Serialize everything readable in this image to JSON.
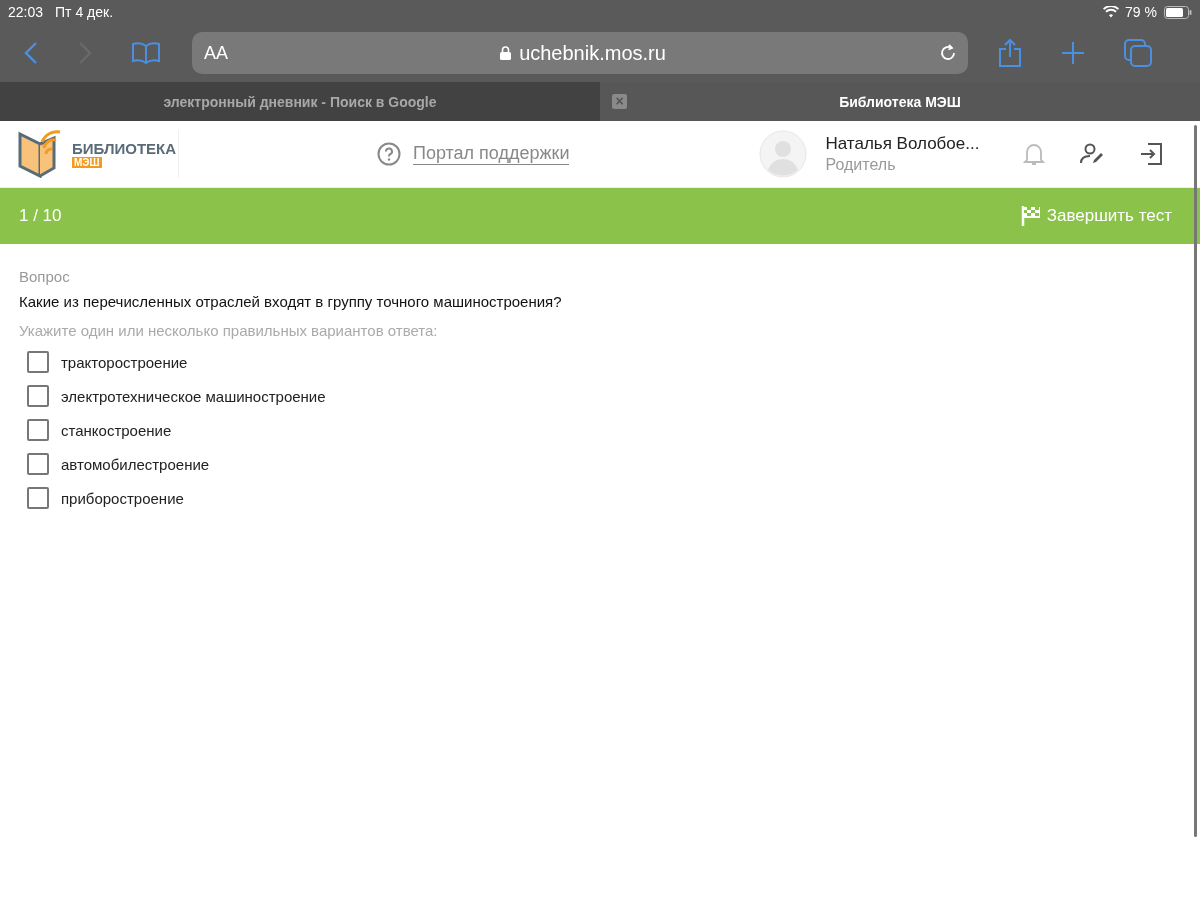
{
  "status_bar": {
    "time": "22:03",
    "date": "Пт 4 дек.",
    "battery": "79 %"
  },
  "browser": {
    "text_size": "AA",
    "url": "uchebnik.mos.ru"
  },
  "tabs": [
    {
      "title": "электронный дневник - Поиск в Google",
      "selected": false
    },
    {
      "title": "Библиотека МЭШ",
      "selected": true,
      "close": "×"
    }
  ],
  "site_header": {
    "logo_title": "БИБЛИОТЕКА",
    "logo_sub": "МЭШ",
    "support_link": "Портал поддержки",
    "user_name": "Наталья Волобое...",
    "user_role": "Родитель"
  },
  "test_bar": {
    "counter": "1 / 10",
    "finish": "Завершить тест"
  },
  "question": {
    "label": "Вопрос",
    "text": "Какие из перечисленных отраслей входят в группу точного машиностроения?",
    "hint": "Укажите один или несколько правильных вариантов ответа:",
    "options": [
      {
        "label": "тракторостроение",
        "checked": false
      },
      {
        "label": "электротехническое машиностроение",
        "checked": false
      },
      {
        "label": "станкостроение",
        "checked": false
      },
      {
        "label": "автомобилестроение",
        "checked": false
      },
      {
        "label": "приборостроение",
        "checked": false
      }
    ]
  }
}
